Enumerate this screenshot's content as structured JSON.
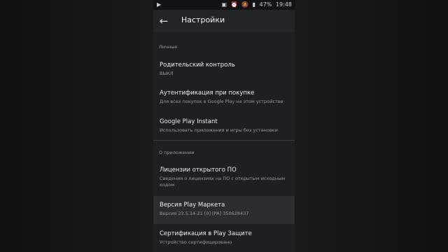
{
  "statusbar": {
    "left_icon": "video-icon",
    "icons": [
      "▣",
      "⏰",
      "🔕",
      "▮"
    ],
    "battery": "47%",
    "time": "19:48"
  },
  "appbar": {
    "back": "←",
    "title": "Настройки"
  },
  "sections": {
    "personal": "Личные",
    "about": "О приложении"
  },
  "items": {
    "parental": {
      "title": "Родительский контроль",
      "subtitle": "ВЫКЛ"
    },
    "auth": {
      "title": "Аутентификация при покупке",
      "subtitle": "Для всех покупок в Google Play на этом устройстве"
    },
    "instant": {
      "title": "Google Play Instant",
      "subtitle": "Использовать приложения и игры без установки"
    },
    "licenses": {
      "title": "Лицензии открытого ПО",
      "subtitle": "Сведения о лицензиях на ПО с открытым исходным кодом"
    },
    "version": {
      "title": "Версия Play Маркета",
      "subtitle": "Версия 23.5.14-21 [0] [PA] 350628437"
    },
    "protect": {
      "title": "Сертификация в Play Защите",
      "subtitle": "Устройство сертифицировано"
    }
  }
}
